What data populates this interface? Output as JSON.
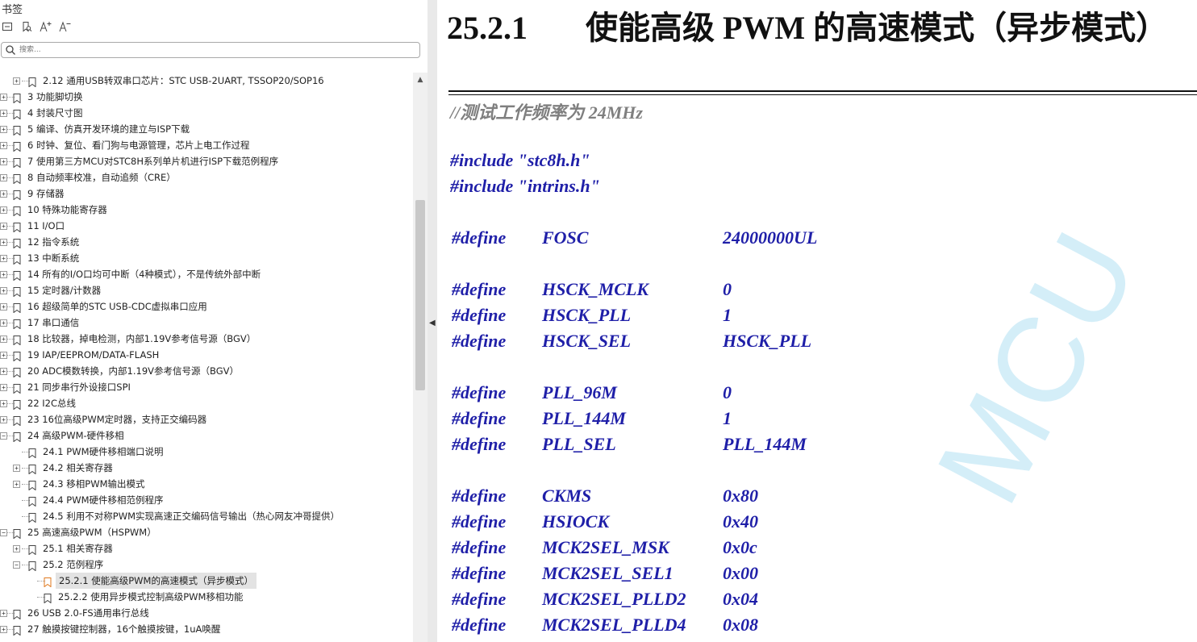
{
  "sidebar": {
    "title": "书签",
    "search_placeholder": "搜索...",
    "items": [
      {
        "label": "2.12  通用USB转双串口芯片：STC USB-2UART, TSSOP20/SOP16",
        "level": 1,
        "expand": "+"
      },
      {
        "label": "3  功能脚切换",
        "level": 0,
        "expand": "+"
      },
      {
        "label": "4  封装尺寸图",
        "level": 0,
        "expand": "+"
      },
      {
        "label": "5  编译、仿真开发环境的建立与ISP下载",
        "level": 0,
        "expand": "+"
      },
      {
        "label": "6  时钟、复位、看门狗与电源管理，芯片上电工作过程",
        "level": 0,
        "expand": "+"
      },
      {
        "label": "7  使用第三方MCU对STC8H系列单片机进行ISP下载范例程序",
        "level": 0,
        "expand": "+"
      },
      {
        "label": "8  自动频率校准，自动追频（CRE）",
        "level": 0,
        "expand": "+"
      },
      {
        "label": "9  存储器",
        "level": 0,
        "expand": "+"
      },
      {
        "label": "10  特殊功能寄存器",
        "level": 0,
        "expand": "+"
      },
      {
        "label": "11  I/O口",
        "level": 0,
        "expand": "+"
      },
      {
        "label": "12  指令系统",
        "level": 0,
        "expand": "+"
      },
      {
        "label": "13  中断系统",
        "level": 0,
        "expand": "+"
      },
      {
        "label": "14  所有的I/O口均可中断（4种模式），不是传统外部中断",
        "level": 0,
        "expand": "+"
      },
      {
        "label": "15  定时器/计数器",
        "level": 0,
        "expand": "+"
      },
      {
        "label": "16  超级简单的STC USB-CDC虚拟串口应用",
        "level": 0,
        "expand": "+"
      },
      {
        "label": "17  串口通信",
        "level": 0,
        "expand": "+"
      },
      {
        "label": "18  比较器，掉电检测，内部1.19V参考信号源（BGV）",
        "level": 0,
        "expand": "+"
      },
      {
        "label": "19  IAP/EEPROM/DATA-FLASH",
        "level": 0,
        "expand": "+"
      },
      {
        "label": "20  ADC模数转换，内部1.19V参考信号源（BGV）",
        "level": 0,
        "expand": "+"
      },
      {
        "label": "21  同步串行外设接口SPI",
        "level": 0,
        "expand": "+"
      },
      {
        "label": "22  I2C总线",
        "level": 0,
        "expand": "+"
      },
      {
        "label": "23  16位高级PWM定时器，支持正交编码器",
        "level": 0,
        "expand": "+"
      },
      {
        "label": "24  高级PWM-硬件移相",
        "level": 0,
        "expand": "-"
      },
      {
        "label": "24.1 PWM硬件移相端口说明",
        "level": 1,
        "expand": ""
      },
      {
        "label": "24.2  相关寄存器",
        "level": 1,
        "expand": "+"
      },
      {
        "label": "24.3  移相PWM输出模式",
        "level": 1,
        "expand": "+"
      },
      {
        "label": "24.4  PWM硬件移相范例程序",
        "level": 1,
        "expand": ""
      },
      {
        "label": "24.5 利用不对称PWM实现高速正交编码信号输出（热心网友冲哥提供）",
        "level": 1,
        "expand": ""
      },
      {
        "label": "25  高速高级PWM（HSPWM）",
        "level": 0,
        "expand": "-"
      },
      {
        "label": "25.1 相关寄存器",
        "level": 1,
        "expand": "+"
      },
      {
        "label": "25.2  范例程序",
        "level": 1,
        "expand": "-"
      },
      {
        "label": "25.2.1 使能高级PWM的高速模式（异步模式）",
        "level": 2,
        "expand": "",
        "selected": true
      },
      {
        "label": "25.2.2 使用异步模式控制高级PWM移相功能",
        "level": 2,
        "expand": ""
      },
      {
        "label": "26  USB 2.0-FS通用串行总线",
        "level": 0,
        "expand": "+"
      },
      {
        "label": "27  触摸按键控制器，16个触摸按键，1uA唤醒",
        "level": 0,
        "expand": "+"
      }
    ]
  },
  "doc": {
    "heading_number": "25.2.1",
    "heading_text": "使能高级 PWM 的高速模式（异步模式）",
    "comment": "//测试工作频率为 24MHz",
    "includes": [
      "#include \"stc8h.h\"",
      "#include \"intrins.h\""
    ],
    "defines": [
      [
        {
          "kw": "#define",
          "name": "FOSC",
          "val": "24000000UL"
        }
      ],
      [
        {
          "kw": "#define",
          "name": "HSCK_MCLK",
          "val": "0"
        },
        {
          "kw": "#define",
          "name": "HSCK_PLL",
          "val": "1"
        },
        {
          "kw": "#define",
          "name": "HSCK_SEL",
          "val": "HSCK_PLL"
        }
      ],
      [
        {
          "kw": "#define",
          "name": "PLL_96M",
          "val": "0"
        },
        {
          "kw": "#define",
          "name": "PLL_144M",
          "val": "1"
        },
        {
          "kw": "#define",
          "name": "PLL_SEL",
          "val": "PLL_144M"
        }
      ],
      [
        {
          "kw": "#define",
          "name": "CKMS",
          "val": "0x80"
        },
        {
          "kw": "#define",
          "name": "HSIOCK",
          "val": "0x40"
        },
        {
          "kw": "#define",
          "name": "MCK2SEL_MSK",
          "val": "0x0c"
        },
        {
          "kw": "#define",
          "name": "MCK2SEL_SEL1",
          "val": "0x00"
        },
        {
          "kw": "#define",
          "name": "MCK2SEL_PLLD2",
          "val": "0x04"
        },
        {
          "kw": "#define",
          "name": "MCK2SEL_PLLD4",
          "val": "0x08"
        }
      ]
    ],
    "watermark": "MCU"
  },
  "colors": {
    "code": "#1f1fa8",
    "comment": "#7f7f7f",
    "watermark": "#d4eef8",
    "selected_bookmark": "#e07a1f"
  }
}
